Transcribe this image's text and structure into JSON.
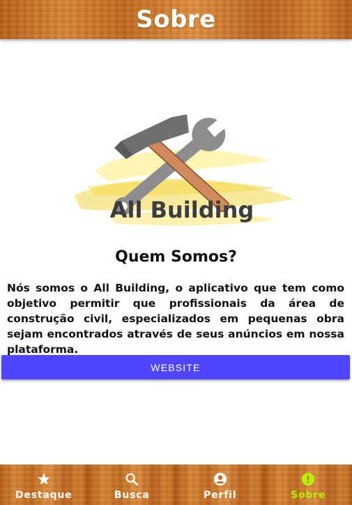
{
  "header": {
    "title": "Sobre"
  },
  "logo": {
    "brand_text": "All Building"
  },
  "about": {
    "heading": "Quem Somos?",
    "body": "Nós somos o All Building, o aplicativo que tem como objetivo permitir que profissionais da área de construção civil, especializados em pequenas obra sejam encontrados através de seus anúncios em nossa plataforma."
  },
  "actions": {
    "website_label": "WEBSITE"
  },
  "tabs": [
    {
      "label": "Destaque",
      "icon": "star-icon",
      "active": false
    },
    {
      "label": "Busca",
      "icon": "search-icon",
      "active": false
    },
    {
      "label": "Perfil",
      "icon": "account-circle-icon",
      "active": false
    },
    {
      "label": "Sobre",
      "icon": "info-alert-icon",
      "active": true
    }
  ],
  "colors": {
    "accent": "#5046ff",
    "active_tab": "#b6f000",
    "wood": "#c87028"
  }
}
